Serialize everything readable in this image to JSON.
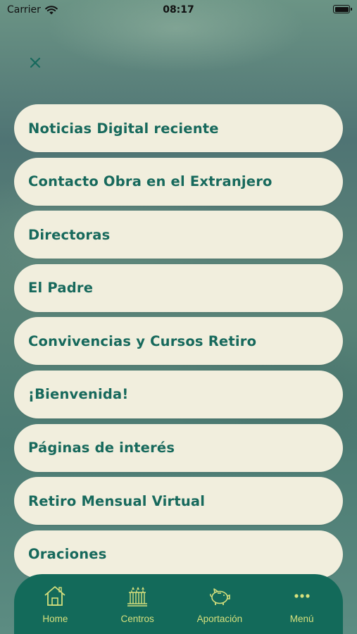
{
  "status_bar": {
    "carrier": "Carrier",
    "time": "08:17"
  },
  "close_icon": "close-icon",
  "menu": {
    "items": [
      {
        "label": "Noticias Digital reciente"
      },
      {
        "label": "Contacto Obra en el Extranjero"
      },
      {
        "label": "Directoras"
      },
      {
        "label": "El Padre"
      },
      {
        "label": "Convivencias y Cursos Retiro"
      },
      {
        "label": "¡Bienvenida!"
      },
      {
        "label": "Páginas de interés"
      },
      {
        "label": "Retiro Mensual Virtual"
      },
      {
        "label": "Oraciones"
      }
    ]
  },
  "tabbar": {
    "tabs": [
      {
        "label": "Home",
        "icon": "house-icon"
      },
      {
        "label": "Centros",
        "icon": "building-icon"
      },
      {
        "label": "Aportación",
        "icon": "piggy-bank-icon"
      },
      {
        "label": "Menú",
        "icon": "ellipsis-icon"
      }
    ]
  },
  "colors": {
    "item_bg": "#f1eedd",
    "item_text": "#17695c",
    "tabbar_bg": "#136a5a",
    "tab_accent": "#d6e07d"
  }
}
